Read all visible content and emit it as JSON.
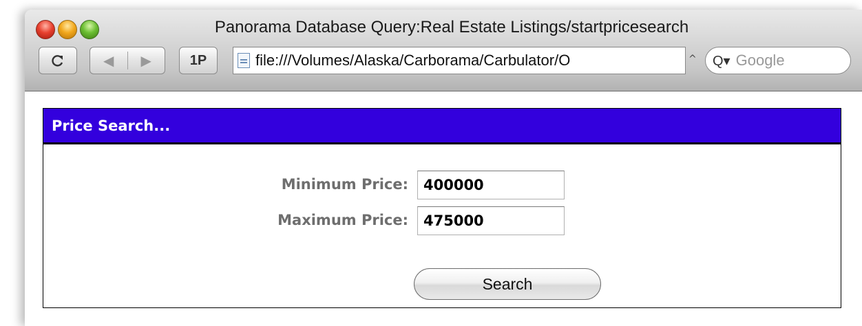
{
  "window": {
    "title": "Panorama Database Query:Real Estate Listings/startpricesearch"
  },
  "toolbar": {
    "reload_icon": "reload-icon",
    "back_icon": "◀",
    "forward_icon": "▶",
    "onep_label": "1P",
    "url": "file:///Volumes/Alaska/Carborama/Carbulator/O",
    "search_placeholder": "Google"
  },
  "form": {
    "header": "Price Search...",
    "min_label": "Minimum Price:",
    "min_value": "400000",
    "max_label": "Maximum Price:",
    "max_value": "475000",
    "submit_label": "Search"
  },
  "colors": {
    "header_bg": "#3300dd",
    "label_gray": "#6e6e6e"
  }
}
